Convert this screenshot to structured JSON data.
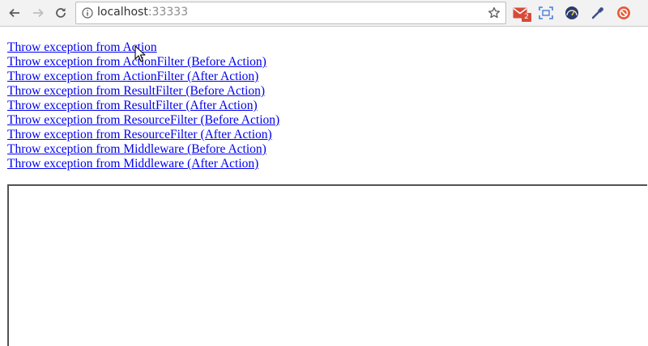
{
  "browser": {
    "url_host": "localhost",
    "url_port": ":33333",
    "extensions": [
      {
        "name": "gmail-checker-icon",
        "badge": "2",
        "color": "#d84a38"
      },
      {
        "name": "screenshot-icon",
        "color": "#4a7dd8"
      },
      {
        "name": "speed-gauge-icon",
        "color": "#2a3b6b"
      },
      {
        "name": "color-picker-icon",
        "color": "#3c4e8a"
      },
      {
        "name": "stop-icon",
        "color": "#e55a3a"
      }
    ]
  },
  "links": [
    "Throw exception from Action",
    "Throw exception from ActionFilter (Before Action)",
    "Throw exception from ActionFilter (After Action)",
    "Throw exception from ResultFilter (Before Action)",
    "Throw exception from ResultFilter (After Action)",
    "Throw exception from ResourceFilter (Before Action)",
    "Throw exception from ResourceFilter (After Action)",
    "Throw exception from Middleware (Before Action)",
    "Throw exception from Middleware (After Action)"
  ],
  "colors": {
    "link": "#0000ee",
    "toolbar": "#f2f2f2"
  }
}
